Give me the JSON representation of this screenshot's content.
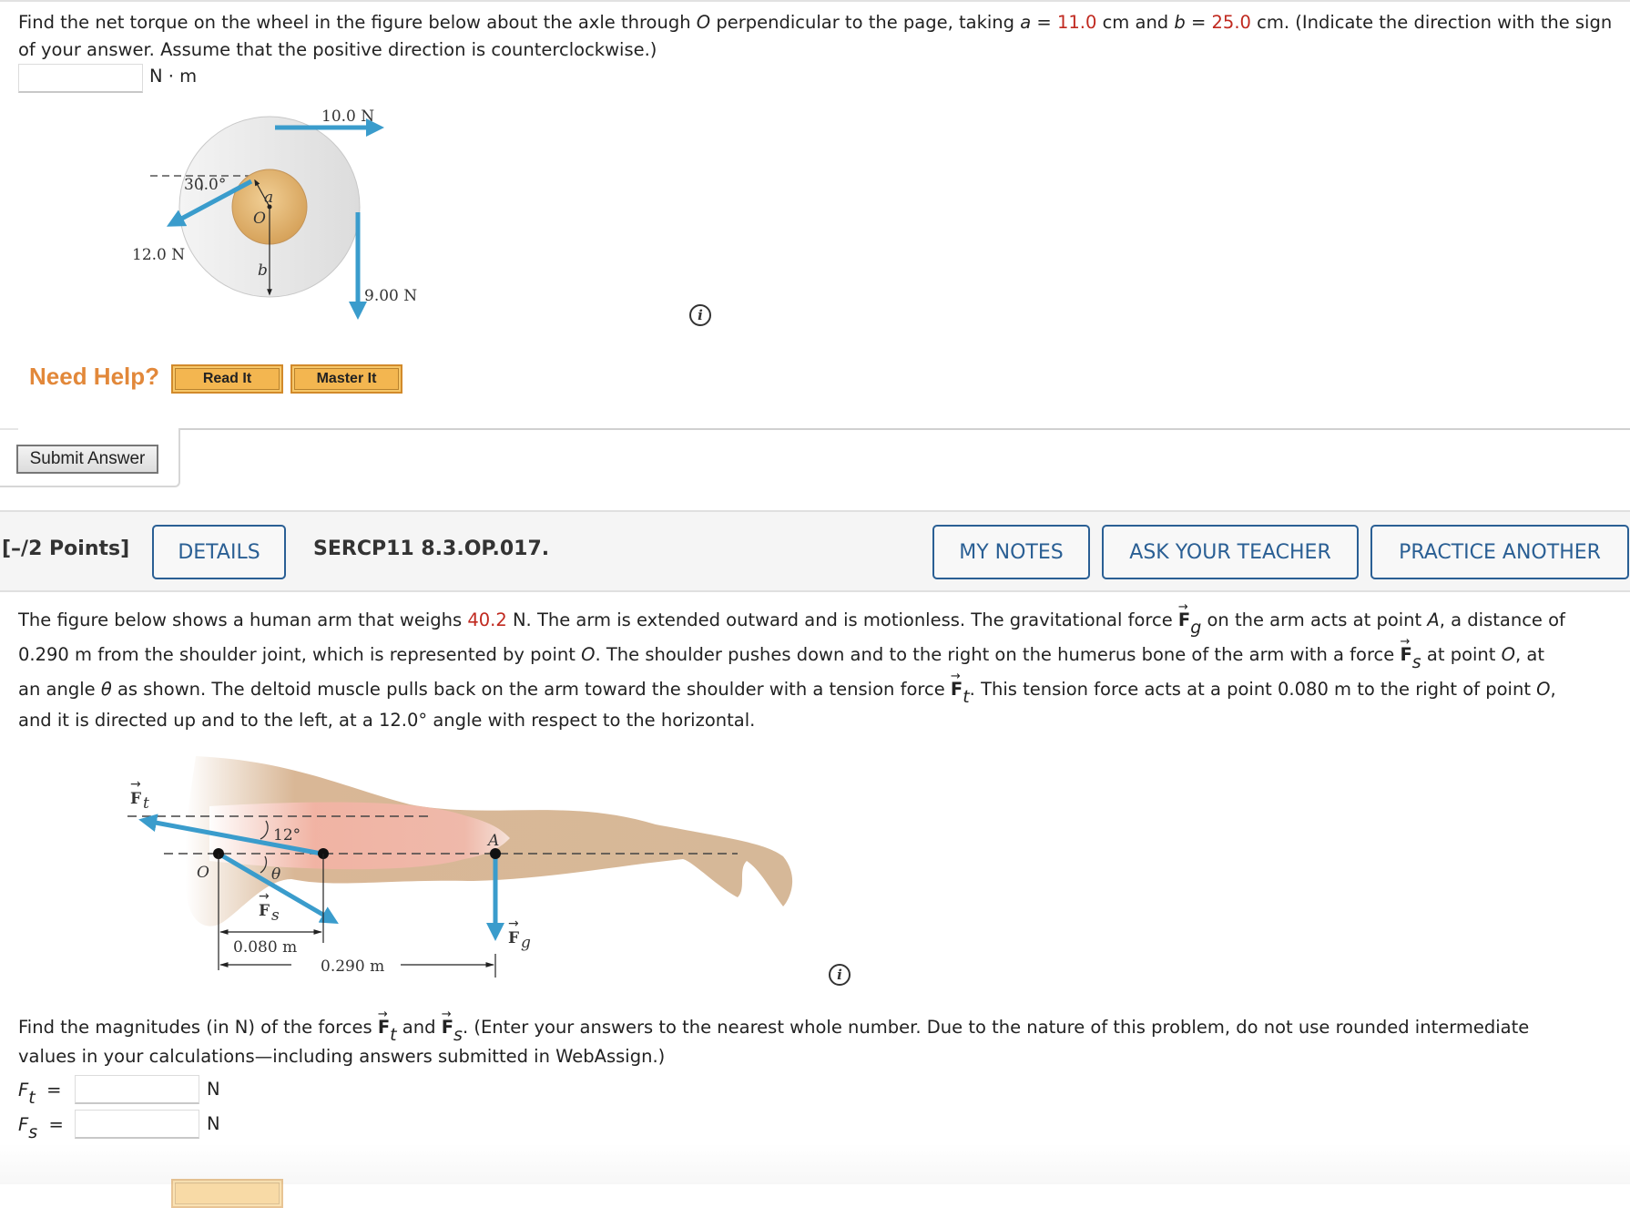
{
  "problem1": {
    "text_parts": [
      "Find the net torque on the wheel in the figure below about the axle through ",
      "O",
      " perpendicular to the page, taking ",
      "a",
      " = ",
      "11.0",
      " cm and ",
      "b",
      " = ",
      "25.0",
      " cm. (Indicate the direction with the sign of your answer. Assume that the positive direction is counterclockwise.)"
    ],
    "answer_value": "",
    "answer_unit": "N · m",
    "figure": {
      "force_top": "10.0 N",
      "force_left": "12.0 N",
      "force_right": "9.00 N",
      "angle": "30.0°",
      "label_a": "a",
      "label_b": "b",
      "label_o": "O"
    },
    "need_help": "Need Help?",
    "read_it": "Read It",
    "master_it": "Master It",
    "submit": "Submit Answer"
  },
  "question_bar": {
    "points": "[–/2 Points]",
    "details": "DETAILS",
    "code": "SERCP11 8.3.OP.017.",
    "my_notes": "MY NOTES",
    "ask_teacher": "ASK YOUR TEACHER",
    "practice_another": "PRACTICE ANOTHER"
  },
  "problem2": {
    "line1_a": "The figure below shows a human arm that weighs ",
    "weight": "40.2",
    "line1_b": " N. The arm is extended outward and is motionless. The gravitational force ",
    "F": "F",
    "g": "g",
    "line1_c": " on the arm acts at point ",
    "A": "A",
    "line1_d": ", a distance of",
    "line2_a": "0.290 m from the shoulder joint, which is represented by point ",
    "O": "O",
    "line2_b": ". The shoulder pushes down and to the right on the humerus bone of the arm with a force ",
    "s": "s",
    "line2_c": " at point ",
    "line2_d": ", at",
    "line3_a": "an angle ",
    "theta": "θ",
    "line3_b": " as shown. The deltoid muscle pulls back on the arm toward the shoulder with a tension force ",
    "t": "t",
    "line3_c": ". This tension force acts at a point 0.080 m to the right of point ",
    "line3_d": ",",
    "line4": "and it is directed up and to the left, at a 12.0° angle with respect to the horizontal.",
    "figure": {
      "angle": "12°",
      "theta": "θ",
      "dist_short": "0.080 m",
      "dist_long": "0.290 m",
      "label_o": "O",
      "label_a": "A",
      "ft": "F",
      "ft_sub": "t",
      "fs": "F",
      "fs_sub": "s",
      "fg": "F",
      "fg_sub": "g"
    },
    "prompt_a": "Find the magnitudes (in N) of the forces ",
    "prompt_and": " and ",
    "prompt_b": ". (Enter your answers to the nearest whole number. Due to the nature of this problem, do not use rounded intermediate",
    "prompt_c": "values in your calculations—including answers submitted in WebAssign.)",
    "ft_label": "F",
    "ft_sub": "t",
    "fs_label": "F",
    "fs_sub": "s",
    "equals": "=",
    "ft_value": "",
    "fs_value": "",
    "unit": "N"
  },
  "icons": {
    "info": "i"
  }
}
